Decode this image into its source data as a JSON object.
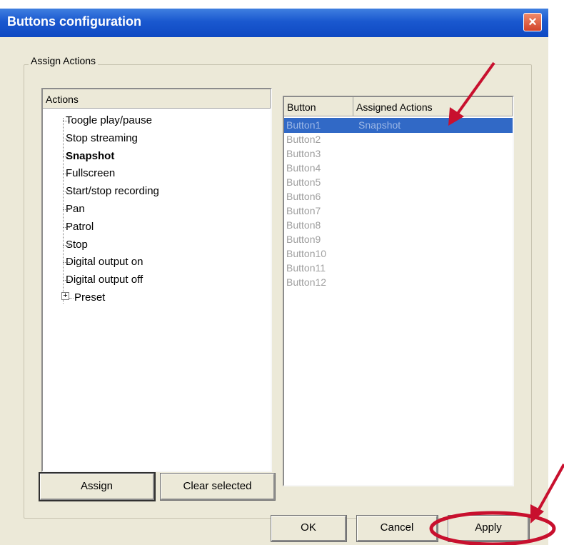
{
  "window": {
    "title": "Buttons configuration",
    "close_glyph": "×"
  },
  "group": {
    "label": "Assign Actions"
  },
  "actions": {
    "header": "Actions",
    "items": [
      {
        "label": "Toogle play/pause",
        "bold": false
      },
      {
        "label": "Stop streaming",
        "bold": false
      },
      {
        "label": "Snapshot",
        "bold": true
      },
      {
        "label": "Fullscreen",
        "bold": false
      },
      {
        "label": "Start/stop recording",
        "bold": false
      },
      {
        "label": "Pan",
        "bold": false
      },
      {
        "label": "Patrol",
        "bold": false
      },
      {
        "label": "Stop",
        "bold": false
      },
      {
        "label": "Digital output on",
        "bold": false
      },
      {
        "label": "Digital output off",
        "bold": false
      },
      {
        "label": "Preset",
        "bold": false,
        "expandable": true,
        "expander_glyph": "+"
      }
    ]
  },
  "buttons_table": {
    "headers": {
      "button": "Button",
      "assigned": "Assigned Actions"
    },
    "rows": [
      {
        "button": "Button1",
        "action": "Snapshot",
        "selected": true
      },
      {
        "button": "Button2",
        "action": ""
      },
      {
        "button": "Button3",
        "action": ""
      },
      {
        "button": "Button4",
        "action": ""
      },
      {
        "button": "Button5",
        "action": ""
      },
      {
        "button": "Button6",
        "action": ""
      },
      {
        "button": "Button7",
        "action": ""
      },
      {
        "button": "Button8",
        "action": ""
      },
      {
        "button": "Button9",
        "action": ""
      },
      {
        "button": "Button10",
        "action": ""
      },
      {
        "button": "Button11",
        "action": ""
      },
      {
        "button": "Button12",
        "action": ""
      }
    ]
  },
  "controls": {
    "assign": "Assign",
    "clear_selected": "Clear selected",
    "ok": "OK",
    "cancel": "Cancel",
    "apply": "Apply"
  },
  "annotations": {
    "color": "#c8102e"
  }
}
